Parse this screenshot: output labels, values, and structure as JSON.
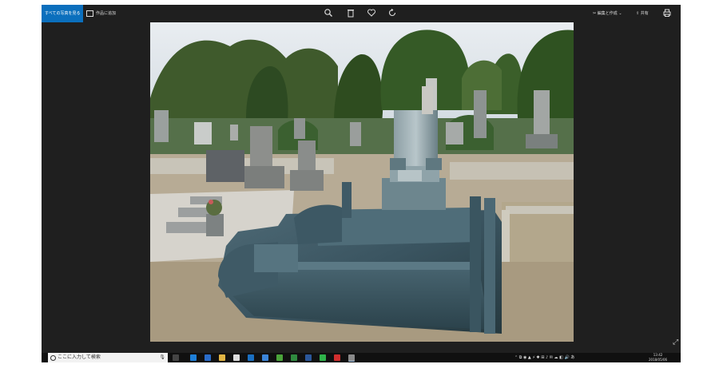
{
  "toolbar": {
    "back_label": "すべての写真を見る",
    "create_label": "作品に追加",
    "edit_label": "編集と作成",
    "share_label": "共有"
  },
  "taskbar": {
    "search_placeholder": "ここに入力して検索",
    "tray_text": "⌃ ⧉ ◉ ▲ ⚡ ✱ ⊞ ♪ ✉ ☁ ◧ 🔊 あ",
    "time": "13:42",
    "date": "2018/05/06"
  },
  "icons": [
    "zoom-icon",
    "delete-icon",
    "heart-icon",
    "rotate-icon",
    "edit-icon",
    "share-icon",
    "print-icon",
    "expand-icon",
    "search-icon",
    "mic-icon",
    "windows-icon"
  ]
}
